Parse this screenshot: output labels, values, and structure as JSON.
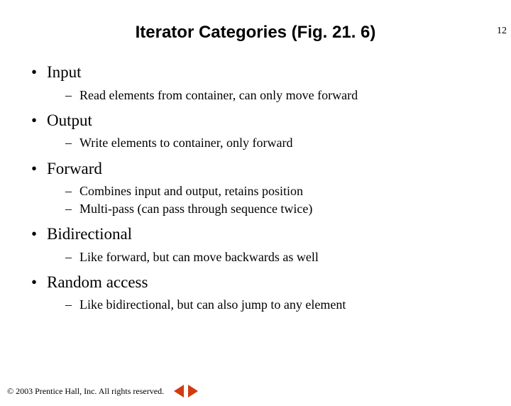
{
  "page_number": "12",
  "title": "Iterator Categories (Fig. 21. 6)",
  "items": [
    {
      "label": "Input",
      "subs": [
        "Read elements from container, can only move forward"
      ]
    },
    {
      "label": "Output",
      "subs": [
        "Write elements to container, only forward"
      ]
    },
    {
      "label": "Forward",
      "subs": [
        "Combines input and output, retains position",
        "Multi-pass (can pass through sequence twice)"
      ]
    },
    {
      "label": "Bidirectional",
      "subs": [
        "Like forward, but can move backwards as well"
      ]
    },
    {
      "label": "Random access",
      "subs": [
        "Like bidirectional, but can also jump to any element"
      ]
    }
  ],
  "footer": {
    "copyright": "© 2003 Prentice Hall, Inc. All rights reserved."
  },
  "colors": {
    "accent": "#d33a0f"
  }
}
